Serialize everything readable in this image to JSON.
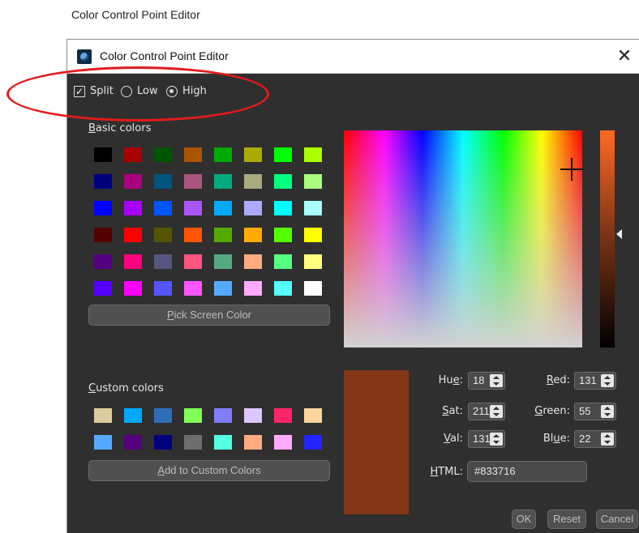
{
  "caption": "Color Control Point Editor",
  "window": {
    "title": "Color Control Point Editor",
    "close_glyph": "✕"
  },
  "options": {
    "split_label": "Split",
    "split_checked": true,
    "low_label": "Low",
    "high_label": "High",
    "selected": "High"
  },
  "basic_colors_label": "Basic colors",
  "basic_colors": [
    [
      "#000000",
      "#aa0000",
      "#005500",
      "#aa5500",
      "#00aa00",
      "#aaaa00",
      "#00ff00",
      "#aaff00"
    ],
    [
      "#00007f",
      "#aa007f",
      "#00557f",
      "#aa557f",
      "#00aa7f",
      "#aaaa7f",
      "#00ff7f",
      "#aaff7f"
    ],
    [
      "#0000ff",
      "#aa00ff",
      "#0055ff",
      "#aa55ff",
      "#00aaff",
      "#aaaaff",
      "#00ffff",
      "#aaffff"
    ],
    [
      "#550000",
      "#ff0000",
      "#555500",
      "#ff5500",
      "#55aa00",
      "#ffaa00",
      "#55ff00",
      "#ffff00"
    ],
    [
      "#55007f",
      "#ff007f",
      "#55557f",
      "#ff557f",
      "#55aa7f",
      "#ffaa7f",
      "#55ff7f",
      "#ffff7f"
    ],
    [
      "#5500ff",
      "#ff00ff",
      "#5555ff",
      "#ff55ff",
      "#55aaff",
      "#ffaaff",
      "#55ffff",
      "#ffffff"
    ]
  ],
  "pick_screen_label": "Pick Screen Color",
  "custom_colors_label": "Custom colors",
  "custom_colors": [
    [
      "#ddcc9e",
      "#00aaff",
      "#2e6eb8",
      "#80ff55",
      "#7e7eff",
      "#ddc6ff",
      "#ff2468",
      "#ffd59c"
    ],
    [
      "#55aaff",
      "#55007f",
      "#00007f",
      "#6d6d6d",
      "#55ffe2",
      "#ffaa7f",
      "#ffaaff",
      "#2424ff"
    ]
  ],
  "add_custom_label": "Add to Custom Colors",
  "current_color": "#833716",
  "fields": {
    "hue": {
      "label": "Hue:",
      "value": "18"
    },
    "sat": {
      "label": "Sat:",
      "value": "211"
    },
    "val": {
      "label": "Val:",
      "value": "131"
    },
    "red": {
      "label": "Red:",
      "value": "131"
    },
    "green": {
      "label": "Green:",
      "value": "55"
    },
    "blue": {
      "label": "Blue:",
      "value": "22"
    },
    "html": {
      "label": "HTML:",
      "value": "#833716"
    }
  },
  "buttons": {
    "ok": "OK",
    "reset": "Reset",
    "cancel": "Cancel"
  }
}
